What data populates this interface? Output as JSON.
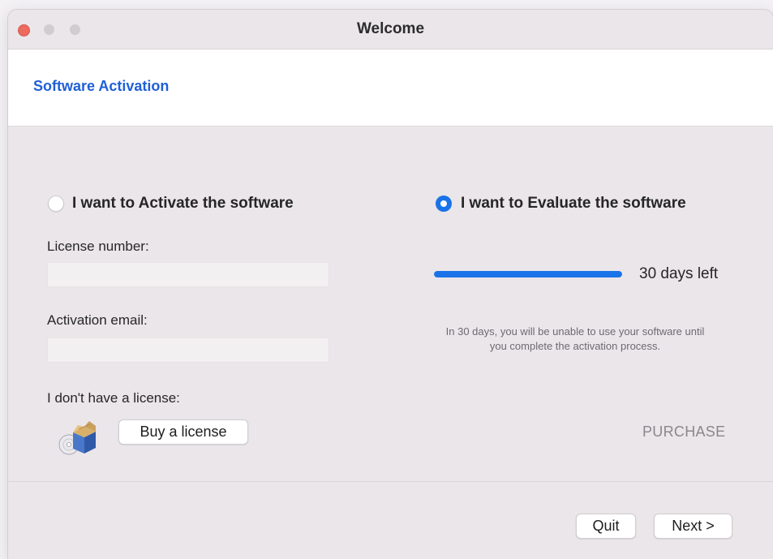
{
  "window": {
    "title": "Welcome"
  },
  "header": {
    "title": "Software Activation"
  },
  "activate": {
    "option_label": "I want to Activate the software",
    "selected": false,
    "license_label": "License number:",
    "license_value": "",
    "email_label": "Activation email:",
    "email_value": "",
    "no_license_label": "I don't have a license:",
    "buy_button": "Buy a license",
    "icon": "package-installer-icon"
  },
  "evaluate": {
    "option_label": "I want to Evaluate the software",
    "selected": true,
    "days_left_text": "30 days left",
    "progress_fraction": 1.0,
    "note": "In 30 days, you will be unable to use your software until you complete the activation process.",
    "purchase_link": "PURCHASE"
  },
  "footer": {
    "quit_button": "Quit",
    "next_button": "Next >"
  },
  "colors": {
    "accent": "#1a73e8",
    "header_title": "#1f5fd6",
    "close_button": "#ed6a5e",
    "window_bg": "#ebe6ea"
  }
}
